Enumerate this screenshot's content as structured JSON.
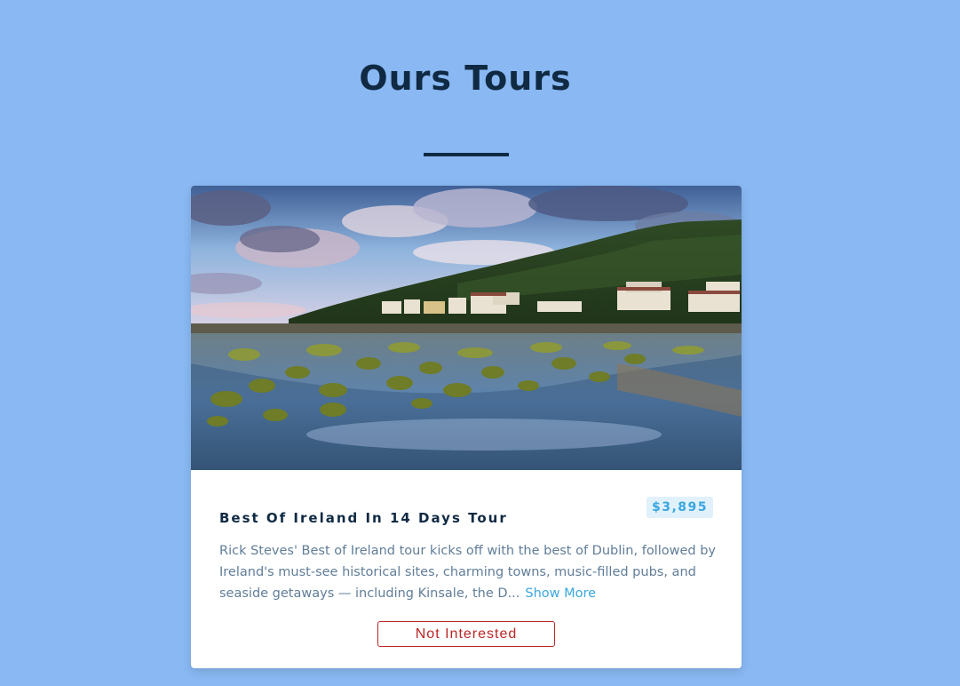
{
  "header": {
    "title": "Ours Tours"
  },
  "tours": [
    {
      "name": "Best Of Ireland In 14 Days Tour",
      "price": "$3,895",
      "description": "Rick Steves' Best of Ireland tour kicks off with the best of Dublin, followed by Ireland's must-see historical sites, charming towns, music-filled pubs, and seaside getaways — including Kinsale, the D...",
      "show_more_label": "Show More",
      "not_interested_label": "Not Interested"
    }
  ],
  "colors": {
    "background": "#89b8f2",
    "title": "#102a43",
    "price_text": "#3aa7df",
    "price_bg": "#e1f1fb",
    "body_text": "#617d98",
    "danger": "#bb2525"
  }
}
